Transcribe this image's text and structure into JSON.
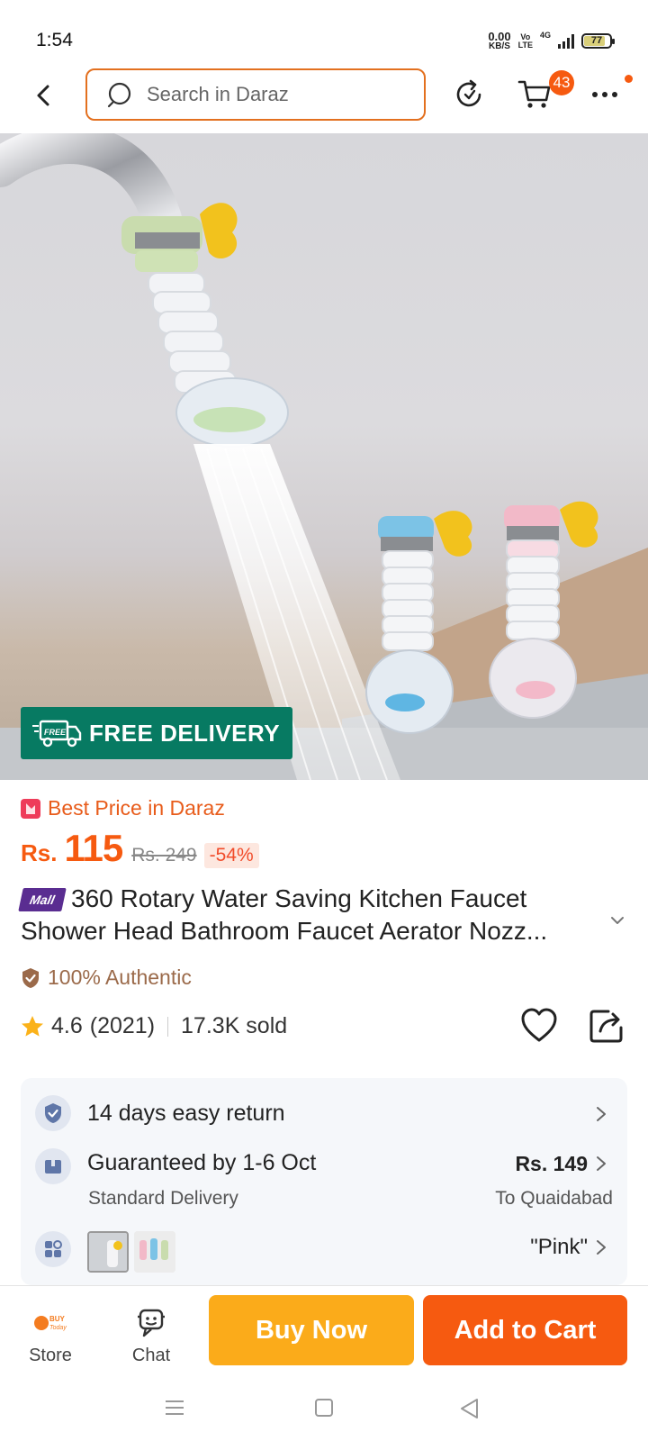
{
  "status": {
    "time": "1:54",
    "net_speed_value": "0.00",
    "net_speed_unit": "KB/S",
    "volte_top": "Vo",
    "volte_bottom": "LTE",
    "network": "4G",
    "battery": "77"
  },
  "search": {
    "placeholder": "Search in Daraz"
  },
  "cart": {
    "badge_count": "43"
  },
  "hero": {
    "free_delivery_truck_text": "FREE",
    "free_delivery_label": "FREE DELIVERY"
  },
  "product": {
    "best_price_label": "Best Price in Daraz",
    "currency": "Rs.",
    "price": "115",
    "original_price": "Rs. 249",
    "discount": "-54%",
    "mall_badge": "Mall",
    "title": "360 Rotary Water Saving Kitchen Faucet Shower Head Bathroom Faucet Aerator Nozz...",
    "authentic_label": "100% Authentic",
    "rating": "4.6",
    "review_count": "(2021)",
    "sold": "17.3K sold"
  },
  "services": {
    "returns_label": "14 days easy return",
    "delivery_label": "Guaranteed by 1-6 Oct",
    "delivery_type": "Standard Delivery",
    "delivery_fee": "Rs. 149",
    "delivery_location": "To Quaidabad",
    "variant_selected": "\"Pink\""
  },
  "bottom_bar": {
    "store_label": "Store",
    "store_logo_text": "BUY Today",
    "chat_label": "Chat",
    "buy_now_label": "Buy Now",
    "add_to_cart_label": "Add to Cart"
  },
  "colors": {
    "brand_orange": "#f65a10",
    "buy_now_yellow": "#fbab1a",
    "free_delivery_green": "#077a62",
    "mall_purple": "#5a2d91"
  }
}
